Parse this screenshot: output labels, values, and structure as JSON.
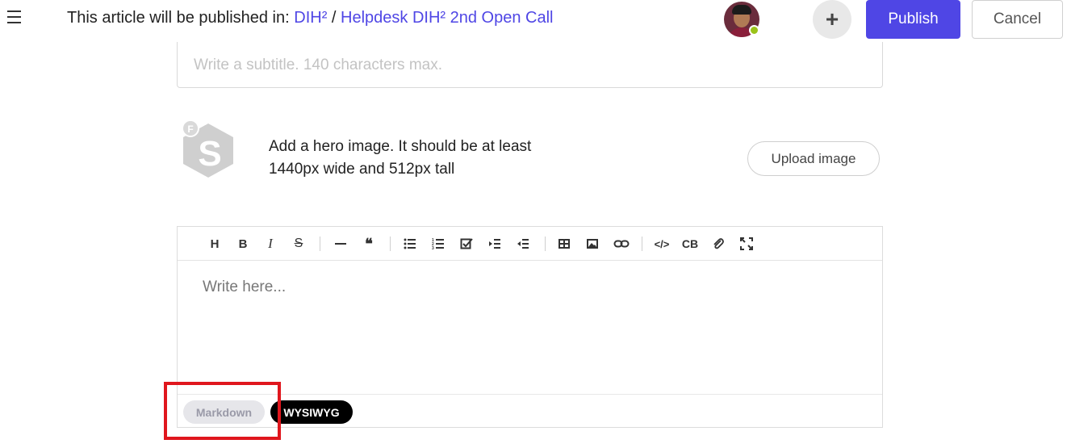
{
  "header": {
    "menu_icon": "hamburger-menu-icon",
    "publish_prefix": "This article will be published in: ",
    "space": "DIH²",
    "separator": " / ",
    "collection": "Helpdesk DIH² 2nd Open Call",
    "add_icon": "plus-icon",
    "publish_label": "Publish",
    "cancel_label": "Cancel",
    "status_color": "#9bc31a",
    "accent_color": "#4f46e5"
  },
  "subtitle": {
    "placeholder": "Write a subtitle. 140 characters max."
  },
  "hero": {
    "logo_icon": "sharepoint-s-logo-icon",
    "line1": "Add a hero image. It should be at least",
    "line2": "1440px wide and 512px tall",
    "upload_label": "Upload image"
  },
  "toolbar": {
    "heading": "H",
    "bold": "B",
    "italic": "I",
    "strike": "S",
    "quote": "❝",
    "code_block": "CB",
    "code": "</>"
  },
  "editor": {
    "placeholder": "Write here..."
  },
  "modes": {
    "markdown": "Markdown",
    "wysiwyg": "WYSIWYG",
    "active": "WYSIWYG"
  }
}
